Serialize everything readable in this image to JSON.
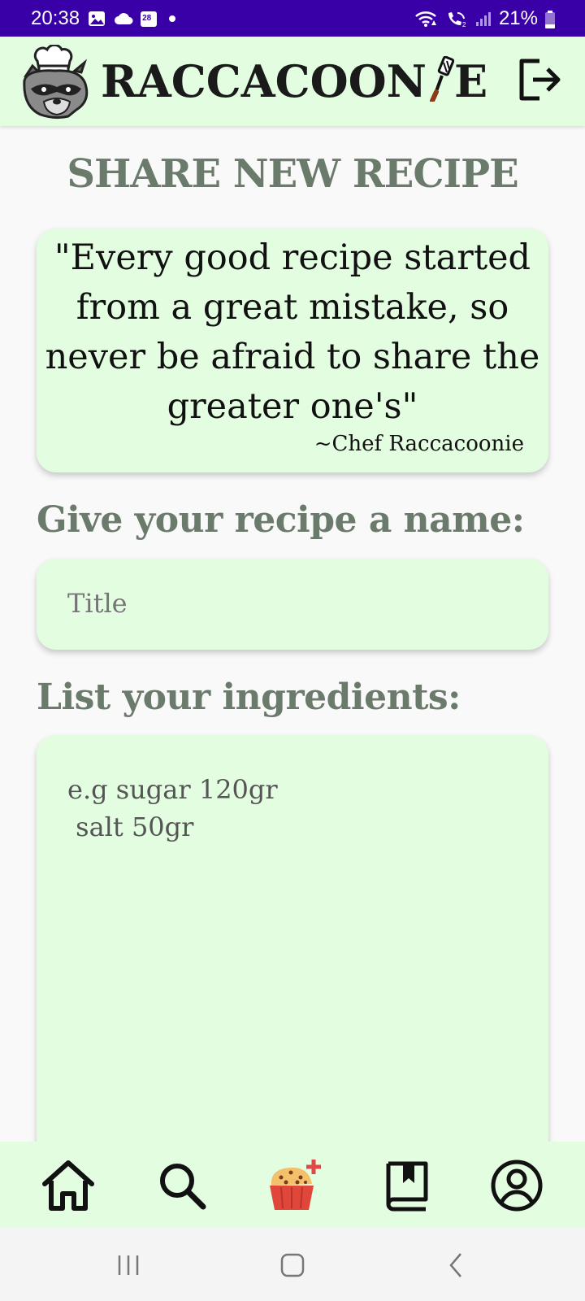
{
  "status_bar": {
    "time": "20:38",
    "battery": "21%",
    "icons_left": [
      "gallery-icon",
      "cloud-icon",
      "calendar-icon",
      "dot-icon"
    ],
    "icons_right": [
      "wifi-icon",
      "wifi-calling-icon",
      "signal-icon",
      "battery-icon"
    ],
    "calendar_day": "28",
    "background_color": "#3a00a8"
  },
  "header": {
    "app_name_part1": "RACCACOON",
    "app_name_part2": "E",
    "background_color": "#e3fde0"
  },
  "page": {
    "title": "SHARE NEW RECIPE"
  },
  "quote": {
    "text": "\"Every good recipe started from a great mistake, so never be afraid to share the greater one's\"",
    "author": "~Chef Raccacoonie"
  },
  "form": {
    "name_label": "Give your recipe a name:",
    "title_placeholder": "Title",
    "ingredients_label": "List your ingredients:",
    "ingredients_placeholder": "e.g sugar 120gr\n salt 50gr"
  },
  "bottom_nav": {
    "items": [
      "home-icon",
      "search-icon",
      "add-recipe-icon",
      "saved-recipes-icon",
      "profile-icon"
    ]
  },
  "colors": {
    "accent_green": "#e3fde0",
    "heading_gray_green": "#6b7b6b",
    "status_purple": "#3a00a8"
  }
}
